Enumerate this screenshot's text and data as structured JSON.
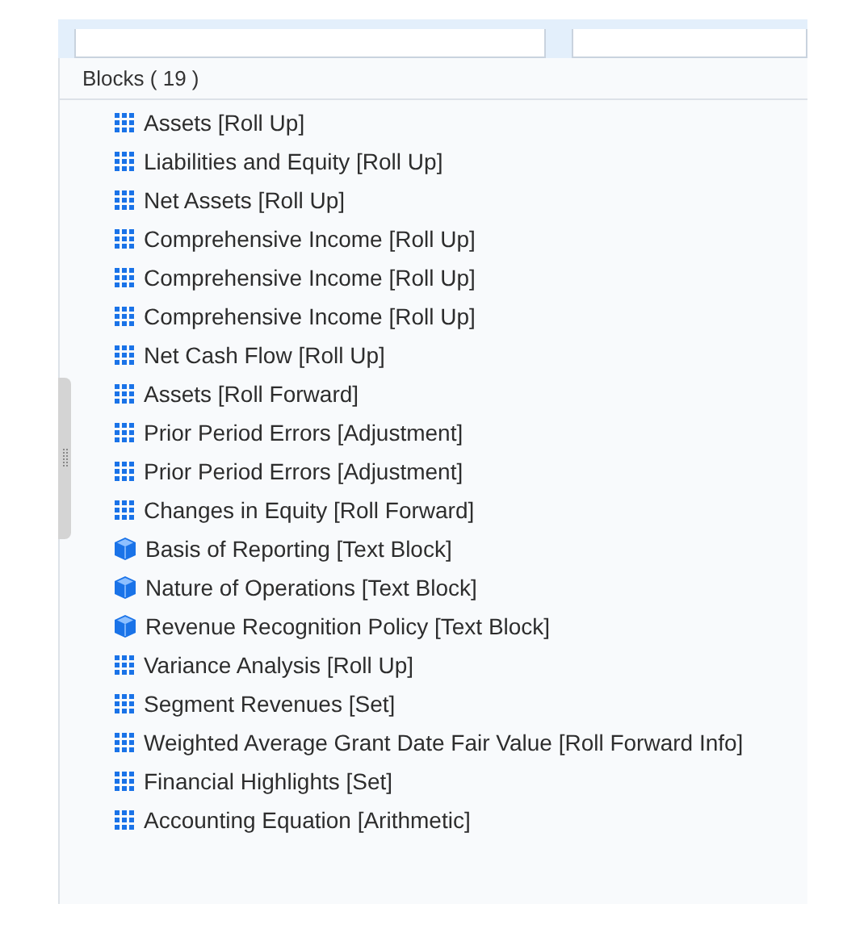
{
  "panel": {
    "title": "Blocks ( 19 )",
    "items": [
      {
        "label": "Assets [Roll Up]",
        "kind": "grid"
      },
      {
        "label": "Liabilities and Equity [Roll Up]",
        "kind": "grid"
      },
      {
        "label": "Net Assets [Roll Up]",
        "kind": "grid"
      },
      {
        "label": "Comprehensive Income [Roll Up]",
        "kind": "grid"
      },
      {
        "label": "Comprehensive Income [Roll Up]",
        "kind": "grid"
      },
      {
        "label": "Comprehensive Income [Roll Up]",
        "kind": "grid"
      },
      {
        "label": "Net Cash Flow [Roll Up]",
        "kind": "grid"
      },
      {
        "label": "Assets [Roll Forward]",
        "kind": "grid"
      },
      {
        "label": "Prior Period Errors [Adjustment]",
        "kind": "grid"
      },
      {
        "label": "Prior Period Errors [Adjustment]",
        "kind": "grid"
      },
      {
        "label": "Changes in Equity [Roll Forward]",
        "kind": "grid"
      },
      {
        "label": "Basis of Reporting [Text Block]",
        "kind": "cube"
      },
      {
        "label": "Nature of Operations [Text Block]",
        "kind": "cube"
      },
      {
        "label": "Revenue Recognition Policy [Text Block]",
        "kind": "cube"
      },
      {
        "label": "Variance Analysis [Roll Up]",
        "kind": "grid"
      },
      {
        "label": "Segment Revenues [Set]",
        "kind": "grid"
      },
      {
        "label": "Weighted Average Grant Date Fair Value [Roll Forward Info]",
        "kind": "grid"
      },
      {
        "label": "Financial Highlights [Set]",
        "kind": "grid"
      },
      {
        "label": "Accounting Equation [Arithmetic]",
        "kind": "grid"
      }
    ]
  }
}
